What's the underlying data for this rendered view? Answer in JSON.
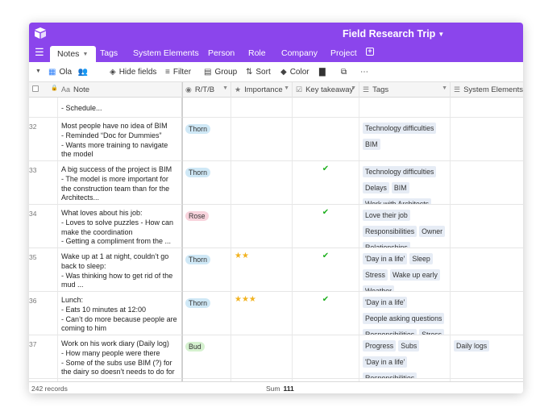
{
  "app": {
    "base_title": "Field Research Trip"
  },
  "tabs": [
    {
      "label": "Notes",
      "active": true
    },
    {
      "label": "Tags"
    },
    {
      "label": "System Elements"
    },
    {
      "label": "Person"
    },
    {
      "label": "Role"
    },
    {
      "label": "Company"
    },
    {
      "label": "Project"
    }
  ],
  "toolbar": {
    "view_name": "Ola",
    "hide_fields": "Hide fields",
    "filter": "Filter",
    "group": "Group",
    "sort": "Sort",
    "color": "Color"
  },
  "columns": {
    "note": "Note",
    "rtb": "R/T/B",
    "importance": "Importance",
    "key_takeaway": "Key takeaway",
    "tags": "Tags",
    "system_elements": "System Elements"
  },
  "partial_top_note": "- Schedule...",
  "rows": [
    {
      "num": "32",
      "note": "Most people have no idea of BIM\n- Reminded “Doc for Dummies”\n- Wants more training to navigate the model",
      "rtb": "Thorn",
      "importance": "",
      "key": false,
      "tags": [
        "Technology difficulties",
        "BIM"
      ],
      "sys": []
    },
    {
      "num": "33",
      "note": "A big success of the project is BIM\n- The model is more important for the construction team than for the Architects...",
      "rtb": "Thorn",
      "importance": "",
      "key": true,
      "tags": [
        "Technology difficulties",
        "Delays",
        "BIM",
        "Work with Architects"
      ],
      "sys": []
    },
    {
      "num": "34",
      "note": "What loves about his job:\n- Loves to solve puzzles - How can make the coordination\n- Getting a compliment from the ...",
      "rtb": "Rose",
      "importance": "",
      "key": true,
      "tags": [
        "Love their job",
        "Responsibilities",
        "Owner",
        "Relationships"
      ],
      "sys": []
    },
    {
      "num": "35",
      "note": "Wake up at 1 at night, couldn’t go back to sleep:\n- Was thinking how to get rid of the mud ...",
      "rtb": "Thorn",
      "importance": "★★",
      "key": true,
      "tags": [
        "'Day in a life'",
        "Sleep",
        "Stress",
        "Wake up early",
        "Weather"
      ],
      "sys": []
    },
    {
      "num": "36",
      "note": "Lunch:\n- Eats 10 minutes at 12:00\n- Can’t do more because people are coming to him",
      "rtb": "Thorn",
      "importance": "★★★",
      "key": true,
      "tags": [
        "'Day in a life'",
        "People asking questions",
        "Responsibilities",
        "Stress"
      ],
      "sys": []
    },
    {
      "num": "37",
      "note": "Work on his work diary (Daily log)\n- How many people were there\n- Some of the subs use BIM (?) for the dairy so doesn’t needs to do for the...",
      "rtb": "Bud",
      "importance": "",
      "key": false,
      "tags": [
        "Progress",
        "Subs",
        "'Day in a life'",
        "Responsibilities"
      ],
      "sys": [
        "Daily logs"
      ]
    }
  ],
  "footer": {
    "records": "242 records",
    "sum_label": "Sum",
    "sum_value": "111"
  },
  "colors": {
    "accent": "#8b45ec",
    "thorn": "#cfe8f6",
    "rose": "#f8d3dc",
    "bud": "#d5f1cf"
  }
}
